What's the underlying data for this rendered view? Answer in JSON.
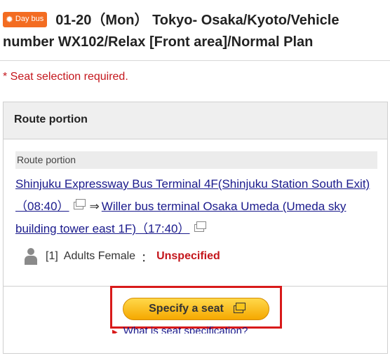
{
  "header": {
    "badge": "Day bus",
    "title_line1": "01-20（Mon）  Tokyo- Osaka/Kyoto/Vehicle",
    "title_line2": "number WX102/Relax [Front area]/Normal Plan"
  },
  "notice": "* Seat selection required.",
  "panel": {
    "heading": "Route portion",
    "route_label": "Route portion",
    "departure": "Shinjuku Expressway Bus Terminal 4F(Shinjuku Station South Exit)（08:40）",
    "arrow": "⇒",
    "arrival": "Willer bus terminal Osaka Umeda (Umeda sky building tower east 1F)（17:40）",
    "passenger": {
      "index": "[1]",
      "type": "Adults Female",
      "separator": "：",
      "status": "Unspecified"
    },
    "specify_button": "Specify a seat",
    "help_link": "What is seat specification?"
  },
  "colors": {
    "badge": "#f36c21",
    "required_red": "#c4161c",
    "link_blue": "#1a1a8c",
    "button_gold": "#f5a800",
    "highlight_red": "#d81a1a"
  }
}
